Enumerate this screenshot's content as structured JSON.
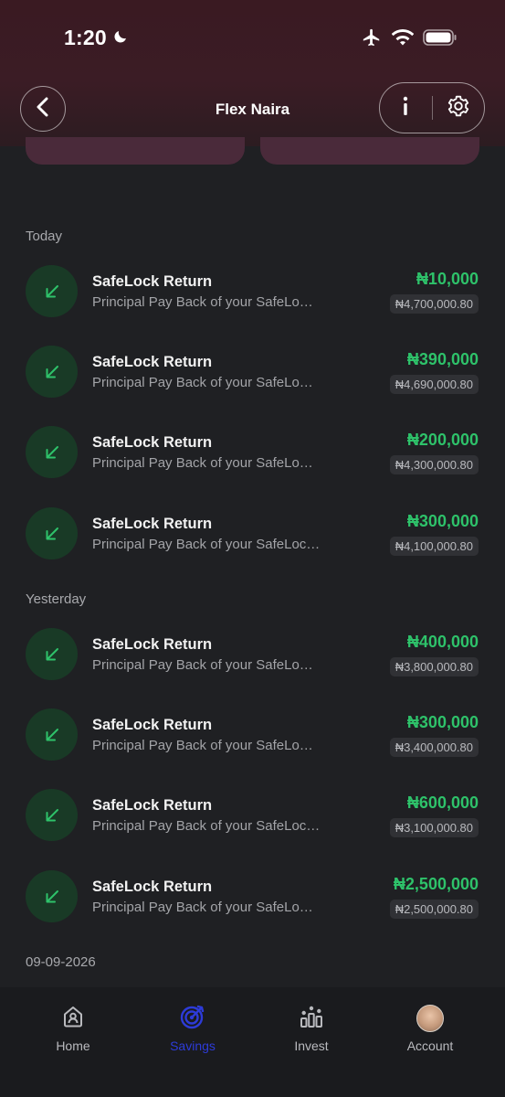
{
  "status_bar": {
    "time": "1:20"
  },
  "nav": {
    "title": "Flex Naira"
  },
  "sections": [
    {
      "label": "Today",
      "items": [
        {
          "title": "SafeLock Return",
          "desc": "Principal Pay Back of your SafeLo…",
          "amount": "₦10,000",
          "balance": "₦4,700,000.80"
        },
        {
          "title": "SafeLock Return",
          "desc": "Principal Pay Back of your SafeLo…",
          "amount": "₦390,000",
          "balance": "₦4,690,000.80"
        },
        {
          "title": "SafeLock Return",
          "desc": "Principal Pay Back of your SafeLo…",
          "amount": "₦200,000",
          "balance": "₦4,300,000.80"
        },
        {
          "title": "SafeLock Return",
          "desc": "Principal Pay Back of your SafeLoc…",
          "amount": "₦300,000",
          "balance": "₦4,100,000.80"
        }
      ]
    },
    {
      "label": "Yesterday",
      "items": [
        {
          "title": "SafeLock Return",
          "desc": "Principal Pay Back of your SafeLo…",
          "amount": "₦400,000",
          "balance": "₦3,800,000.80"
        },
        {
          "title": "SafeLock Return",
          "desc": "Principal Pay Back of your SafeLo…",
          "amount": "₦300,000",
          "balance": "₦3,400,000.80"
        },
        {
          "title": "SafeLock Return",
          "desc": "Principal Pay Back of your SafeLoc…",
          "amount": "₦600,000",
          "balance": "₦3,100,000.80"
        },
        {
          "title": "SafeLock Return",
          "desc": "Principal Pay Back of your SafeLo…",
          "amount": "₦2,500,000",
          "balance": "₦2,500,000.80"
        }
      ]
    },
    {
      "label": "09-09-2026",
      "items": []
    }
  ],
  "bottom_nav": [
    {
      "label": "Home",
      "icon": "home-icon",
      "active": false
    },
    {
      "label": "Savings",
      "icon": "savings-target-icon",
      "active": true
    },
    {
      "label": "Invest",
      "icon": "invest-icon",
      "active": false
    },
    {
      "label": "Account",
      "icon": "avatar",
      "active": false
    }
  ],
  "colors": {
    "background": "#1f2023",
    "credit_green": "#2ec26a",
    "active_blue": "#2d3bd8",
    "icon_circle": "#193a26"
  }
}
